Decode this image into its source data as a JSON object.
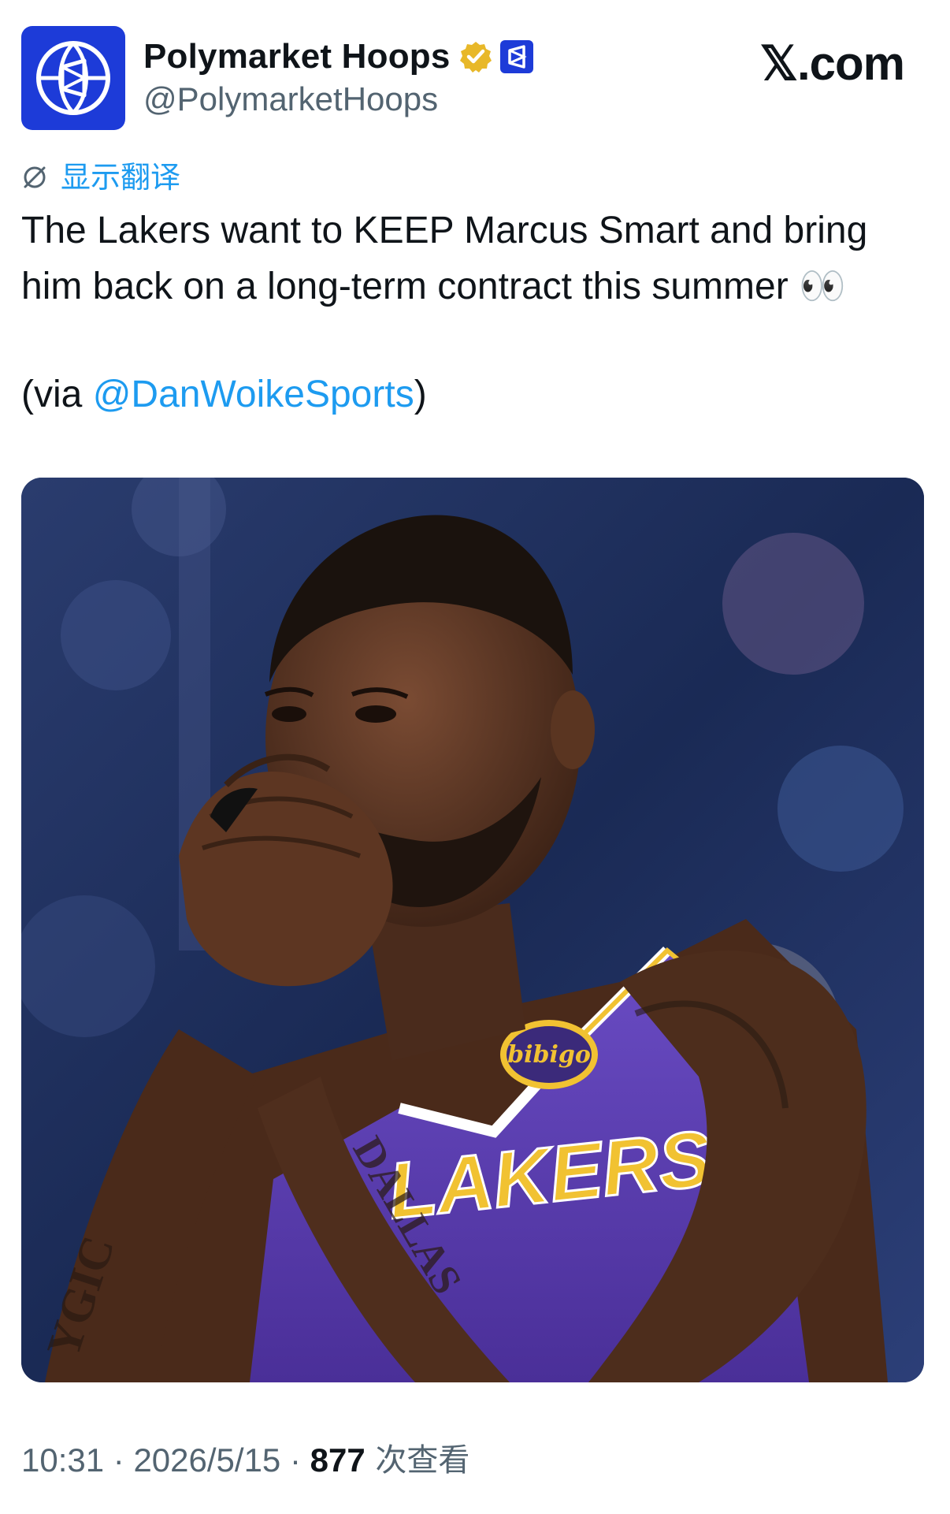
{
  "author": {
    "display_name": "Polymarket Hoops",
    "handle": "@PolymarketHoops",
    "avatar_icon": "polymarket-basketball-logo",
    "verified_icon": "gold-verified-badge",
    "affiliate_icon": "polymarket-affiliate-badge"
  },
  "site": {
    "label": "𝕏.com"
  },
  "translate": {
    "icon": "globe-translate-icon",
    "label": "显示翻译"
  },
  "tweet": {
    "text": "The Lakers want to KEEP Marcus Smart and bring\nhim back on a long-term contract this summer",
    "emoji": "👀",
    "via_prefix": "(via ",
    "via_mention": "@DanWoikeSports",
    "via_suffix": ")"
  },
  "media": {
    "jersey_sponsor": "bibigo",
    "jersey_wordmark": "LAKERS",
    "arm_tattoo_left": "YGIC",
    "arm_tattoo_right": "DALLAS"
  },
  "meta": {
    "time": "10:31",
    "separator": " · ",
    "date": "2026/5/15",
    "views_count": "877",
    "views_label": " 次查看"
  },
  "colors": {
    "link": "#1d9bf0",
    "muted": "#536471",
    "text": "#0f1419",
    "avatar_bg": "#1d3bd8",
    "verified_gold": "#e8b829",
    "jersey_purple": "#5b3fb0"
  }
}
